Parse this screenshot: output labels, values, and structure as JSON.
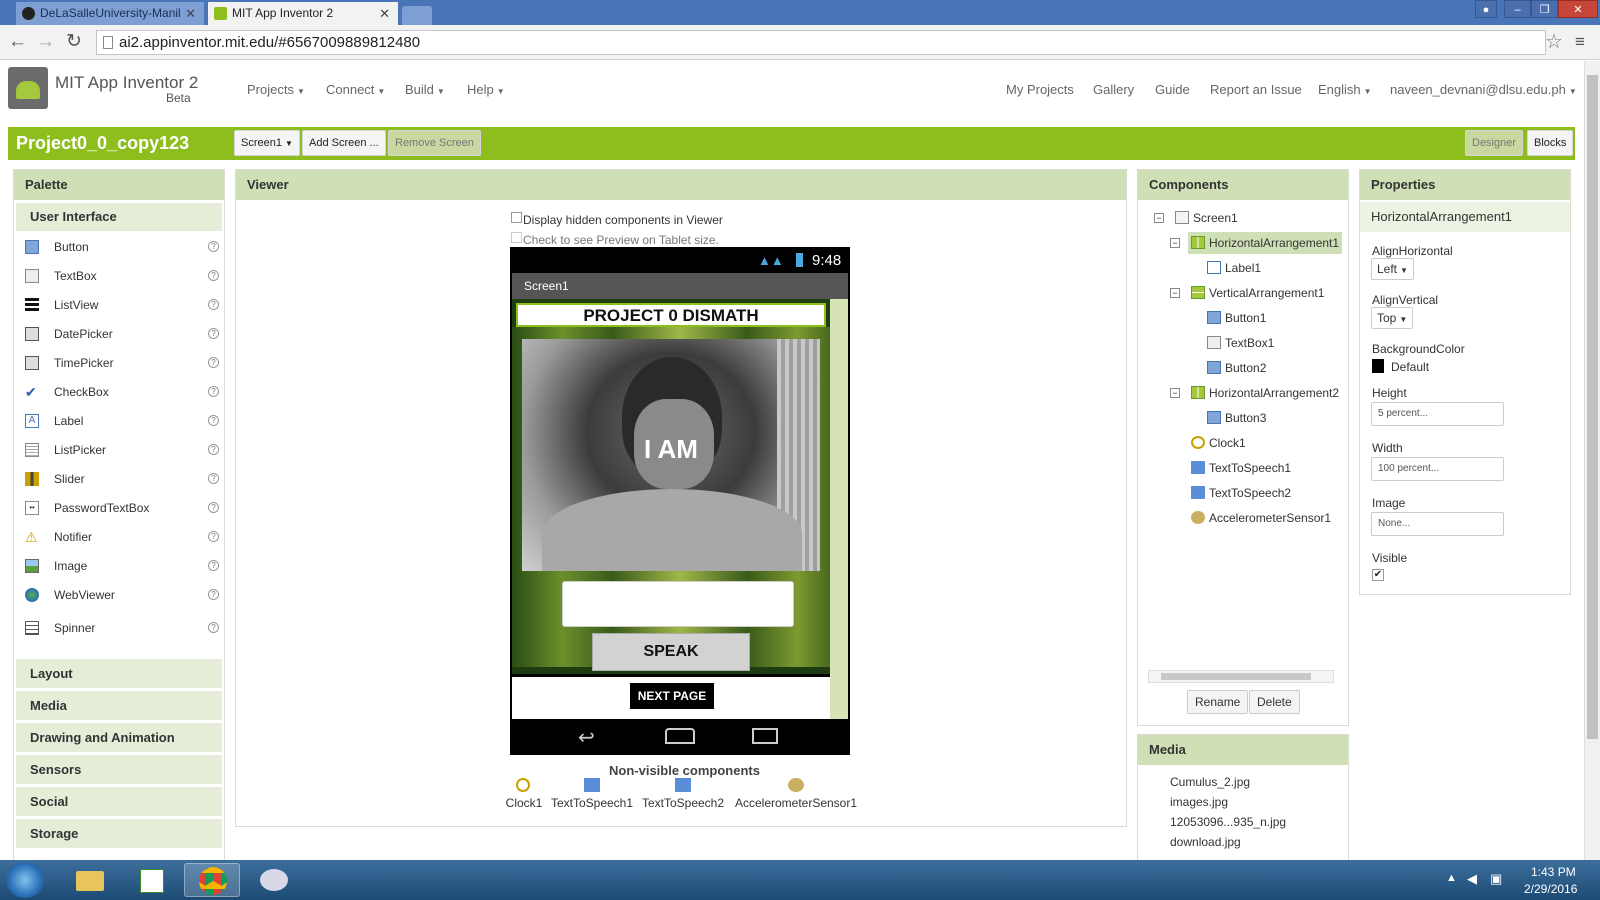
{
  "browser": {
    "tabs": [
      {
        "title": "DeLaSalleUniversity-Manil",
        "active": false
      },
      {
        "title": "MIT App Inventor 2",
        "active": true
      }
    ],
    "url": "ai2.appinventor.mit.edu/#6567009889812480"
  },
  "header": {
    "app_name": "MIT App Inventor 2",
    "beta": "Beta",
    "menus": [
      "Projects",
      "Connect",
      "Build",
      "Help"
    ],
    "links": [
      "My Projects",
      "Gallery",
      "Guide",
      "Report an Issue"
    ],
    "language": "English",
    "user": "naveen_devnani@dlsu.edu.ph"
  },
  "project_bar": {
    "project_name": "Project0_0_copy123",
    "screen_select": "Screen1",
    "add_screen": "Add Screen ...",
    "remove_screen": "Remove Screen",
    "designer": "Designer",
    "blocks": "Blocks"
  },
  "palette": {
    "title": "Palette",
    "section": "User Interface",
    "items": [
      "Button",
      "TextBox",
      "ListView",
      "DatePicker",
      "TimePicker",
      "CheckBox",
      "Label",
      "ListPicker",
      "Slider",
      "PasswordTextBox",
      "Notifier",
      "Image",
      "WebViewer",
      "Spinner"
    ],
    "help_glyph": "?",
    "categories": [
      "Layout",
      "Media",
      "Drawing and Animation",
      "Sensors",
      "Social",
      "Storage"
    ]
  },
  "viewer": {
    "title": "Viewer",
    "display_hidden": "Display hidden components in Viewer",
    "tablet_preview": "Check to see Preview on Tablet size.",
    "phone": {
      "time": "9:48",
      "screen_title": "Screen1",
      "heading": "PROJECT 0 DISMATH",
      "overlay_text": "I AM",
      "speak_button": "SPEAK",
      "next_button": "NEXT PAGE"
    },
    "non_visible_title": "Non-visible components",
    "non_visible": [
      "Clock1",
      "TextToSpeech1",
      "TextToSpeech2",
      "AccelerometerSensor1"
    ]
  },
  "components": {
    "title": "Components",
    "tree": [
      {
        "name": "Screen1",
        "icon": "screen-icon",
        "level": 0,
        "toggle": "−"
      },
      {
        "name": "HorizontalArrangement1",
        "icon": "horizontal-arrangement-icon",
        "level": 1,
        "toggle": "−",
        "selected": true
      },
      {
        "name": "Label1",
        "icon": "label-icon",
        "level": 2
      },
      {
        "name": "VerticalArrangement1",
        "icon": "vertical-arrangement-icon",
        "level": 1,
        "toggle": "−"
      },
      {
        "name": "Button1",
        "icon": "button-icon",
        "level": 2
      },
      {
        "name": "TextBox1",
        "icon": "textbox-icon",
        "level": 2
      },
      {
        "name": "Button2",
        "icon": "button-icon",
        "level": 2
      },
      {
        "name": "HorizontalArrangement2",
        "icon": "horizontal-arrangement-icon",
        "level": 1,
        "toggle": "−"
      },
      {
        "name": "Button3",
        "icon": "button-icon",
        "level": 2
      },
      {
        "name": "Clock1",
        "icon": "clock-icon",
        "level": 1
      },
      {
        "name": "TextToSpeech1",
        "icon": "text-to-speech-icon",
        "level": 1
      },
      {
        "name": "TextToSpeech2",
        "icon": "text-to-speech-icon",
        "level": 1
      },
      {
        "name": "AccelerometerSensor1",
        "icon": "accelerometer-icon",
        "level": 1
      }
    ],
    "rename": "Rename",
    "delete": "Delete"
  },
  "media": {
    "title": "Media",
    "files": [
      "Cumulus_2.jpg",
      "images.jpg",
      "12053096...935_n.jpg",
      "download.jpg"
    ]
  },
  "properties": {
    "title": "Properties",
    "component": "HorizontalArrangement1",
    "align_horizontal_label": "AlignHorizontal",
    "align_horizontal_value": "Left",
    "align_vertical_label": "AlignVertical",
    "align_vertical_value": "Top",
    "bg_color_label": "BackgroundColor",
    "bg_color_value": "Default",
    "height_label": "Height",
    "height_value": "5 percent...",
    "width_label": "Width",
    "width_value": "100 percent...",
    "image_label": "Image",
    "image_value": "None...",
    "visible_label": "Visible",
    "visible_checked": true
  },
  "taskbar": {
    "time": "1:43 PM",
    "date": "2/29/2016"
  },
  "colors": {
    "brand_green": "#8dbe1d",
    "panel_header": "#cfe0b6",
    "title_bar": "#4a74b8"
  }
}
